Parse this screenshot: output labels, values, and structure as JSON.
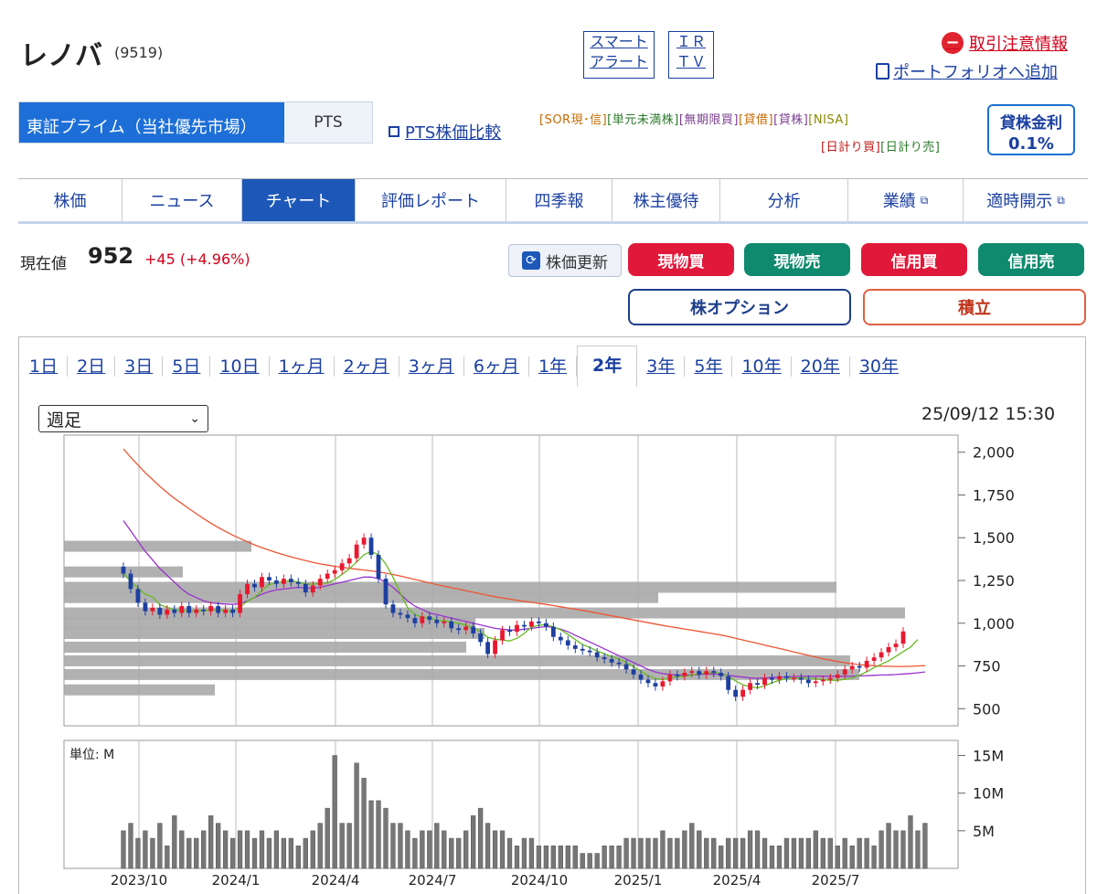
{
  "header": {
    "name": "レノバ",
    "code": "(9519)",
    "smart_alert": [
      "スマート",
      "アラート"
    ],
    "irtv": [
      "ＩＲ",
      "ＴＶ"
    ],
    "warning": "取引注意情報",
    "portfolio": "ポートフォリオへ追加"
  },
  "market": {
    "primary": "東証プライム（当社優先市場）",
    "pts": "PTS",
    "pts_compare": "PTS株価比較"
  },
  "tags": {
    "row1": [
      "[SOR現･信]",
      "[単元未満株]",
      "[無期限買]",
      "[貸借]",
      "[貸株]",
      "[NISA]"
    ],
    "row2": [
      "[日計り買]",
      "[日計り売]"
    ]
  },
  "loan_rate": {
    "label": "貸株金利",
    "value": "0.1%"
  },
  "tabs": [
    {
      "label": "株価",
      "active": false
    },
    {
      "label": "ニュース",
      "active": false
    },
    {
      "label": "チャート",
      "active": true
    },
    {
      "label": "評価レポート",
      "active": false
    },
    {
      "label": "四季報",
      "active": false
    },
    {
      "label": "株主優待",
      "active": false
    },
    {
      "label": "分析",
      "active": false
    },
    {
      "label": "業績",
      "active": false
    },
    {
      "label": "適時開示",
      "active": false
    }
  ],
  "price": {
    "label": "現在値",
    "value": "952",
    "change": "+45 (+4.96%)"
  },
  "actions": {
    "refresh": "株価更新",
    "cash_buy": "現物買",
    "cash_sell": "現物売",
    "margin_buy": "信用買",
    "margin_sell": "信用売",
    "option": "株オプション",
    "tsumitate": "積立"
  },
  "periods": [
    "1日",
    "2日",
    "3日",
    "5日",
    "10日",
    "1ヶ月",
    "2ヶ月",
    "3ヶ月",
    "6ヶ月",
    "1年",
    "2年",
    "3年",
    "5年",
    "10年",
    "20年",
    "30年"
  ],
  "active_period": "2年",
  "chart_select": "週足",
  "datetime": "25/09/12 15:30",
  "colors": {
    "up": "#e8182f",
    "down": "#1d3fa0",
    "ma_short": "#66bb22",
    "ma_mid": "#9933cc",
    "ma_long": "#ee5533"
  },
  "chart_data": {
    "type": "candlestick",
    "ylim": [
      400,
      2100
    ],
    "yticks": [
      "2,000",
      "1,750",
      "1,500",
      "1,250",
      "1,000",
      "750",
      "500"
    ],
    "ytick_values": [
      2000,
      1750,
      1500,
      1250,
      1000,
      750,
      500
    ],
    "xticks": [
      "2023/10",
      "2024/1",
      "2024/4",
      "2024/7",
      "2024/10",
      "2025/1",
      "2025/4",
      "2025/7"
    ],
    "volume_unit_label": "単位: M",
    "volume_yticks": [
      "15M",
      "10M",
      "5M"
    ],
    "volume_ytick_values": [
      15,
      10,
      5
    ],
    "volume_ylim": [
      0,
      17
    ],
    "closes": [
      1290,
      1200,
      1120,
      1070,
      1090,
      1050,
      1080,
      1060,
      1100,
      1060,
      1080,
      1070,
      1100,
      1060,
      1080,
      1060,
      1170,
      1230,
      1210,
      1270,
      1250,
      1230,
      1260,
      1240,
      1230,
      1180,
      1220,
      1260,
      1290,
      1310,
      1350,
      1380,
      1460,
      1500,
      1400,
      1260,
      1110,
      1060,
      1050,
      1030,
      1000,
      1040,
      1020,
      1000,
      1010,
      970,
      960,
      980,
      940,
      890,
      820,
      900,
      960,
      950,
      990,
      980,
      1010,
      1000,
      980,
      920,
      900,
      870,
      850,
      840,
      830,
      800,
      790,
      770,
      760,
      730,
      700,
      670,
      650,
      630,
      660,
      700,
      690,
      710,
      720,
      700,
      720,
      710,
      690,
      610,
      570,
      610,
      650,
      640,
      680,
      670,
      690,
      680,
      680,
      670,
      650,
      660,
      670,
      680,
      700,
      730,
      750,
      740,
      780,
      800,
      830,
      860,
      880,
      952
    ],
    "volumes": [
      5,
      6,
      4,
      5,
      4,
      6,
      3,
      7,
      5,
      4,
      4,
      5,
      7,
      6,
      5,
      4,
      5,
      5,
      4,
      5,
      4,
      5,
      4,
      4,
      3,
      4,
      5,
      6,
      8,
      15,
      6,
      6,
      14,
      12,
      9,
      9,
      8,
      6,
      6,
      5,
      4,
      5,
      5,
      6,
      5,
      4,
      4,
      5,
      7,
      8,
      6,
      5,
      5,
      4,
      3,
      4,
      4,
      3,
      3,
      3,
      3,
      3,
      3,
      2,
      2,
      2,
      3,
      3,
      3,
      4,
      4,
      4,
      4,
      4,
      5,
      4,
      4,
      5,
      6,
      5,
      4,
      4,
      3,
      4,
      4,
      4,
      5,
      5,
      4,
      3,
      3,
      4,
      4,
      4,
      4,
      5,
      4,
      4,
      3,
      4,
      3,
      4,
      4,
      3,
      5,
      6,
      5,
      5,
      7,
      5,
      6
    ],
    "ma_short": [
      1290,
      1245,
      1203,
      1170,
      1154,
      1108,
      1093,
      1076,
      1076,
      1068,
      1076,
      1072,
      1080,
      1076,
      1076,
      1067,
      1095,
      1128,
      1151,
      1190,
      1226,
      1236,
      1245,
      1248,
      1242,
      1228,
      1229,
      1232,
      1236,
      1256,
      1286,
      1318,
      1358,
      1400,
      1420,
      1400,
      1346,
      1268,
      1176,
      1090,
      1050,
      1036,
      1029,
      1018,
      1014,
      1008,
      1000,
      988,
      972,
      950,
      918,
      906,
      902,
      896,
      912,
      940,
      978,
      988,
      992,
      978,
      962,
      934,
      904,
      876,
      858,
      838,
      822,
      804,
      790,
      770,
      746,
      718,
      694,
      676,
      670,
      680,
      686,
      690,
      696,
      706,
      708,
      712,
      708,
      690,
      662,
      640,
      628,
      622,
      634,
      652,
      666,
      676,
      680,
      680,
      678,
      674,
      670,
      666,
      666,
      672,
      680,
      696,
      716,
      740,
      760,
      780,
      806,
      834,
      860,
      904
    ],
    "ma_mid": [
      1600,
      1540,
      1480,
      1420,
      1370,
      1320,
      1280,
      1240,
      1200,
      1170,
      1150,
      1130,
      1120,
      1115,
      1112,
      1110,
      1115,
      1130,
      1150,
      1170,
      1185,
      1195,
      1200,
      1205,
      1210,
      1205,
      1205,
      1210,
      1220,
      1230,
      1240,
      1250,
      1260,
      1270,
      1270,
      1260,
      1240,
      1210,
      1170,
      1130,
      1100,
      1080,
      1060,
      1050,
      1040,
      1030,
      1020,
      1010,
      1000,
      990,
      980,
      970,
      965,
      960,
      960,
      965,
      970,
      975,
      980,
      975,
      965,
      950,
      930,
      910,
      890,
      870,
      850,
      830,
      810,
      790,
      770,
      750,
      730,
      715,
      705,
      700,
      698,
      697,
      698,
      700,
      702,
      703,
      700,
      695,
      690,
      685,
      680,
      678,
      680,
      682,
      684,
      686,
      688,
      689,
      690,
      690,
      690,
      690,
      690,
      690,
      691,
      692,
      693,
      695,
      697,
      698,
      700,
      703,
      706,
      710,
      715
    ],
    "ma_long": [
      2020,
      1970,
      1925,
      1880,
      1840,
      1800,
      1765,
      1730,
      1700,
      1670,
      1640,
      1612,
      1585,
      1560,
      1537,
      1515,
      1495,
      1476,
      1458,
      1442,
      1427,
      1413,
      1400,
      1388,
      1377,
      1366,
      1356,
      1347,
      1340,
      1333,
      1327,
      1321,
      1316,
      1311,
      1306,
      1300,
      1293,
      1285,
      1276,
      1266,
      1256,
      1246,
      1236,
      1226,
      1217,
      1208,
      1199,
      1190,
      1181,
      1172,
      1163,
      1155,
      1148,
      1141,
      1134,
      1128,
      1122,
      1116,
      1110,
      1103,
      1096,
      1089,
      1082,
      1075,
      1067,
      1059,
      1051,
      1043,
      1035,
      1027,
      1019,
      1011,
      1003,
      995,
      987,
      980,
      973,
      966,
      959,
      952,
      945,
      938,
      931,
      922,
      912,
      902,
      892,
      882,
      872,
      862,
      852,
      842,
      832,
      822,
      812,
      802,
      792,
      784,
      776,
      769,
      763,
      758,
      754,
      751,
      749,
      748,
      747,
      747,
      748,
      750,
      752
    ]
  }
}
